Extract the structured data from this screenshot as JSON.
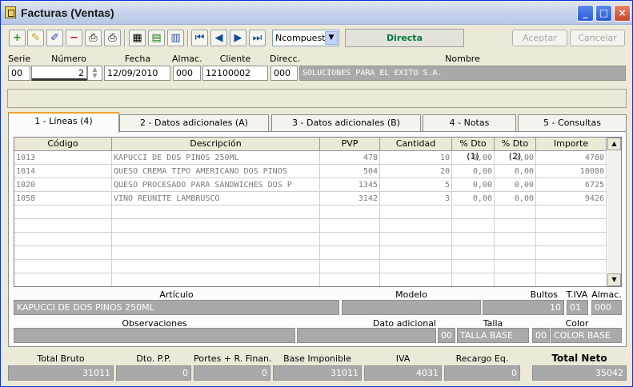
{
  "window": {
    "title": "Facturas (Ventas)"
  },
  "toolbar": {
    "combo_value": "Ncompuesto",
    "mode_label": "Directa",
    "accept_label": "Aceptar",
    "cancel_label": "Cancelar"
  },
  "header": {
    "labels": {
      "serie": "Serie",
      "numero": "Número",
      "fecha": "Fecha",
      "almac": "Almac.",
      "cliente": "Cliente",
      "direcc": "Direcc.",
      "nombre": "Nombre"
    },
    "values": {
      "serie": "00",
      "numero": "2",
      "fecha": "12/09/2010",
      "almac": "000",
      "cliente": "12100002",
      "direcc": "000",
      "nombre": "SOLUCIONES PARA EL EXITO S.A."
    }
  },
  "tabs": [
    {
      "label": "1 - Líneas (4)"
    },
    {
      "label": "2 - Datos adicionales (A)"
    },
    {
      "label": "3 - Datos adicionales (B)"
    },
    {
      "label": "4 - Notas"
    },
    {
      "label": "5 - Consultas"
    }
  ],
  "grid": {
    "columns": [
      "Código",
      "Descripción",
      "PVP",
      "Cantidad",
      "% Dto (1)",
      "% Dto (2)",
      "Importe"
    ],
    "rows": [
      [
        "1013",
        "KAPUCCI DE DOS PINOS 250ML",
        "478",
        "10",
        "0,00",
        "0,00",
        "4780"
      ],
      [
        "1014",
        "QUESO CREMA TIPO AMERICANO DOS PINOS",
        "504",
        "20",
        "0,00",
        "0,00",
        "10080"
      ],
      [
        "1020",
        "QUESO PROCESADO PARA SANDWICHES DOS P",
        "1345",
        "5",
        "0,00",
        "0,00",
        "6725"
      ],
      [
        "1058",
        "VINO REUNITE LAMBRUSCO",
        "3142",
        "3",
        "0,00",
        "0,00",
        "9426"
      ]
    ]
  },
  "detail": {
    "labels": {
      "articulo": "Artículo",
      "modelo": "Modelo",
      "bultos": "Bultos",
      "tiva": "T.IVA",
      "almac": "Almac.",
      "observaciones": "Observaciones",
      "dato_adicional": "Dato adicional",
      "talla": "Talla",
      "color": "Color"
    },
    "values": {
      "articulo": "KAPUCCI DE DOS PINOS 250ML",
      "bultos": "10",
      "tiva": "01",
      "almac": "000",
      "talla_code": "00",
      "talla": "TALLA BASE",
      "color_code": "00",
      "color": "COLOR BASE"
    }
  },
  "totals": {
    "labels": {
      "bruto": "Total Bruto",
      "dto": "Dto. P.P.",
      "portes": "Portes + R. Finan.",
      "base": "Base Imponible",
      "iva": "IVA",
      "recargo": "Recargo Eq.",
      "neto": "Total Neto"
    },
    "values": {
      "bruto": "31011",
      "dto": "0",
      "portes": "0",
      "base": "31011",
      "iva": "4031",
      "recargo": "0",
      "neto": "35042"
    }
  }
}
